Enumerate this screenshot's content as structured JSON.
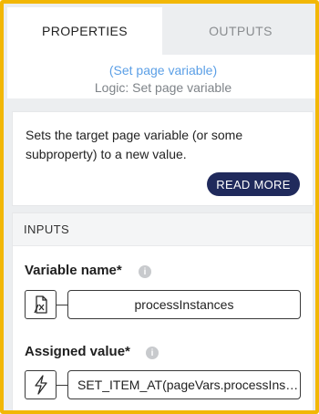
{
  "tabs": [
    {
      "label": "PROPERTIES",
      "active": true
    },
    {
      "label": "OUTPUTS",
      "active": false
    }
  ],
  "header": {
    "title": "(Set page variable)",
    "subtitle": "Logic: Set page variable"
  },
  "description": {
    "text": "Sets the target page variable (or some subproperty) to a new value.",
    "read_more_label": "READ MORE"
  },
  "inputs": {
    "section_title": "INPUTS",
    "fields": [
      {
        "label": "Variable name*",
        "info": "i",
        "icon": "variable-binding-icon",
        "value": "processInstances"
      },
      {
        "label": "Assigned value*",
        "info": "i",
        "icon": "lightning-icon",
        "value": "SET_ITEM_AT(pageVars.processInstances"
      }
    ]
  },
  "colors": {
    "frame_border": "#f2b705",
    "header_title": "#5b9fe6",
    "button_bg": "#202a5c"
  }
}
